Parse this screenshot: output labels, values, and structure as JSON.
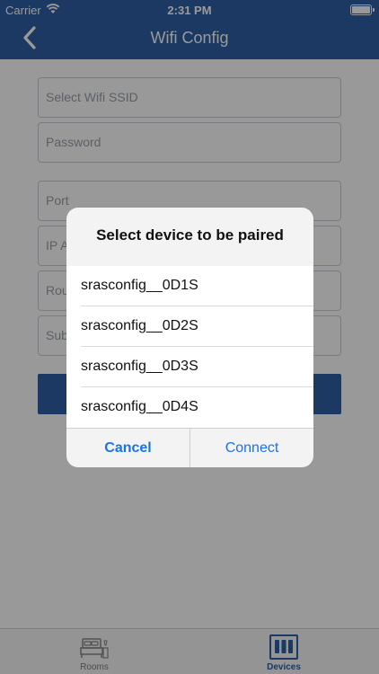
{
  "status_bar": {
    "carrier": "Carrier",
    "time": "2:31 PM"
  },
  "nav": {
    "title": "Wifi Config",
    "back_icon": "chevron-left-icon"
  },
  "form": {
    "ssid_placeholder": "Select Wifi SSID",
    "password_placeholder": "Password",
    "port_placeholder": "Port",
    "ip_placeholder": "IP A",
    "router_placeholder": "Rou",
    "subnet_placeholder": "Sub"
  },
  "alert": {
    "title": "Select device to be paired",
    "devices": [
      "srasconfig__0D1S",
      "srasconfig__0D2S",
      "srasconfig__0D3S",
      "srasconfig__0D4S"
    ],
    "cancel_label": "Cancel",
    "connect_label": "Connect"
  },
  "tabbar": {
    "tabs": [
      {
        "label": "Rooms",
        "icon": "bed-icon",
        "active": false
      },
      {
        "label": "Devices",
        "icon": "devices-icon",
        "active": true
      }
    ]
  },
  "colors": {
    "brand": "#2f5fa6",
    "action": "#1a73e8"
  }
}
